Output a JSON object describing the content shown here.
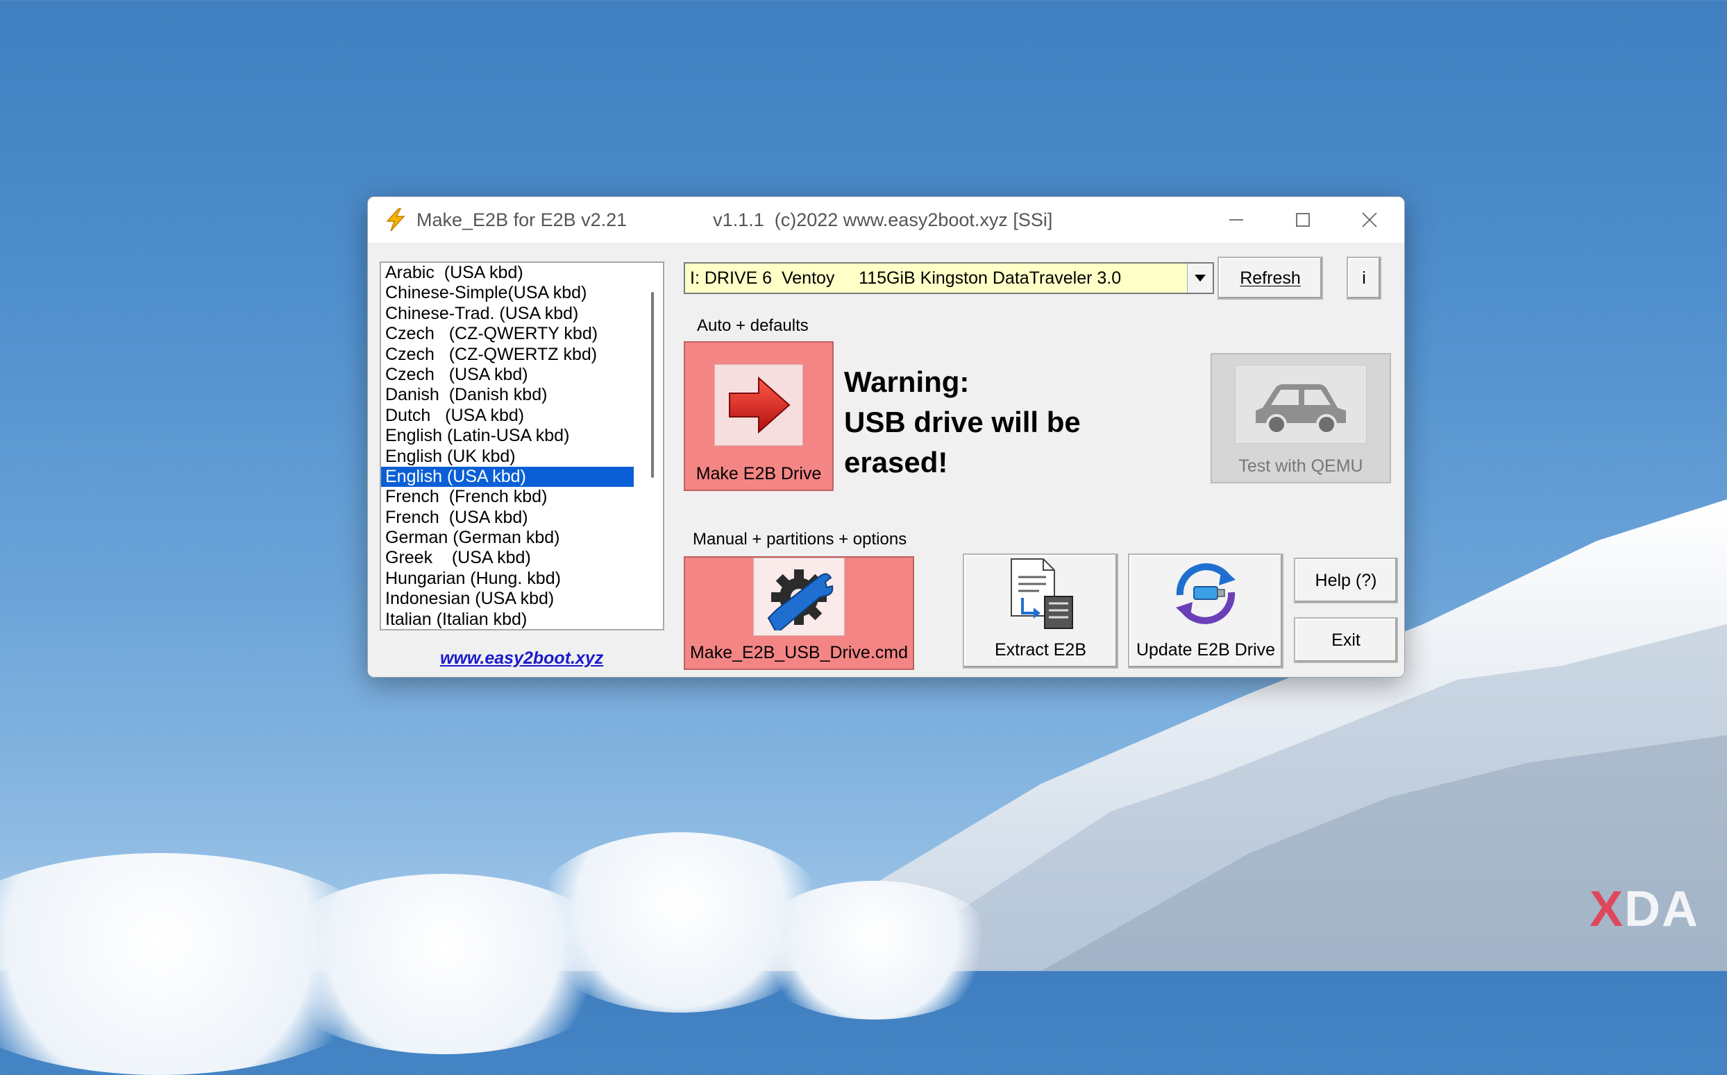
{
  "window": {
    "title": "Make_E2B for E2B v2.21",
    "subtitle": "v1.1.1  (c)2022 www.easy2boot.xyz [SSi]"
  },
  "language_list": {
    "items": [
      "Arabic  (USA kbd)",
      "Chinese-Simple(USA kbd)",
      "Chinese-Trad. (USA kbd)",
      "Czech   (CZ-QWERTY kbd)",
      "Czech   (CZ-QWERTZ kbd)",
      "Czech   (USA kbd)",
      "Danish  (Danish kbd)",
      "Dutch   (USA kbd)",
      "English (Latin-USA kbd)",
      "English (UK kbd)",
      "English (USA kbd)",
      "French  (French kbd)",
      "French  (USA kbd)",
      "German (German kbd)",
      "Greek    (USA kbd)",
      "Hungarian (Hung. kbd)",
      "Indonesian (USA kbd)",
      "Italian (Italian kbd)"
    ],
    "selected": "English (USA kbd)"
  },
  "website_link": "www.easy2boot.xyz",
  "drive": {
    "selected": "I: DRIVE 6  Ventoy     115GiB Kingston DataTraveler 3.0"
  },
  "buttons": {
    "refresh": "Refresh",
    "info": "i",
    "make_drive": "Make E2B Drive",
    "test_qemu": "Test with QEMU",
    "make_cmd": "Make_E2B_USB_Drive.cmd",
    "extract": "Extract E2B",
    "update": "Update E2B Drive",
    "help": "Help (?)",
    "exit": "Exit"
  },
  "labels": {
    "auto": "Auto + defaults",
    "manual": "Manual + partitions + options"
  },
  "warning": {
    "line1": "Warning:",
    "line2": "USB drive will be",
    "line3": "erased!"
  },
  "watermark": {
    "prefix": "X",
    "rest": "DA"
  },
  "colors": {
    "accent_selection": "#0a5fd6",
    "drive_select_bg": "#ffffc8",
    "make_button_bg": "#f48585",
    "link": "#1a1acc"
  },
  "icons": {
    "app": "lightning-icon",
    "make_drive": "red-arrow-icon",
    "test_qemu": "car-icon",
    "make_cmd": "gear-wrench-icon",
    "extract": "document-extract-icon",
    "update": "refresh-usb-icon"
  }
}
